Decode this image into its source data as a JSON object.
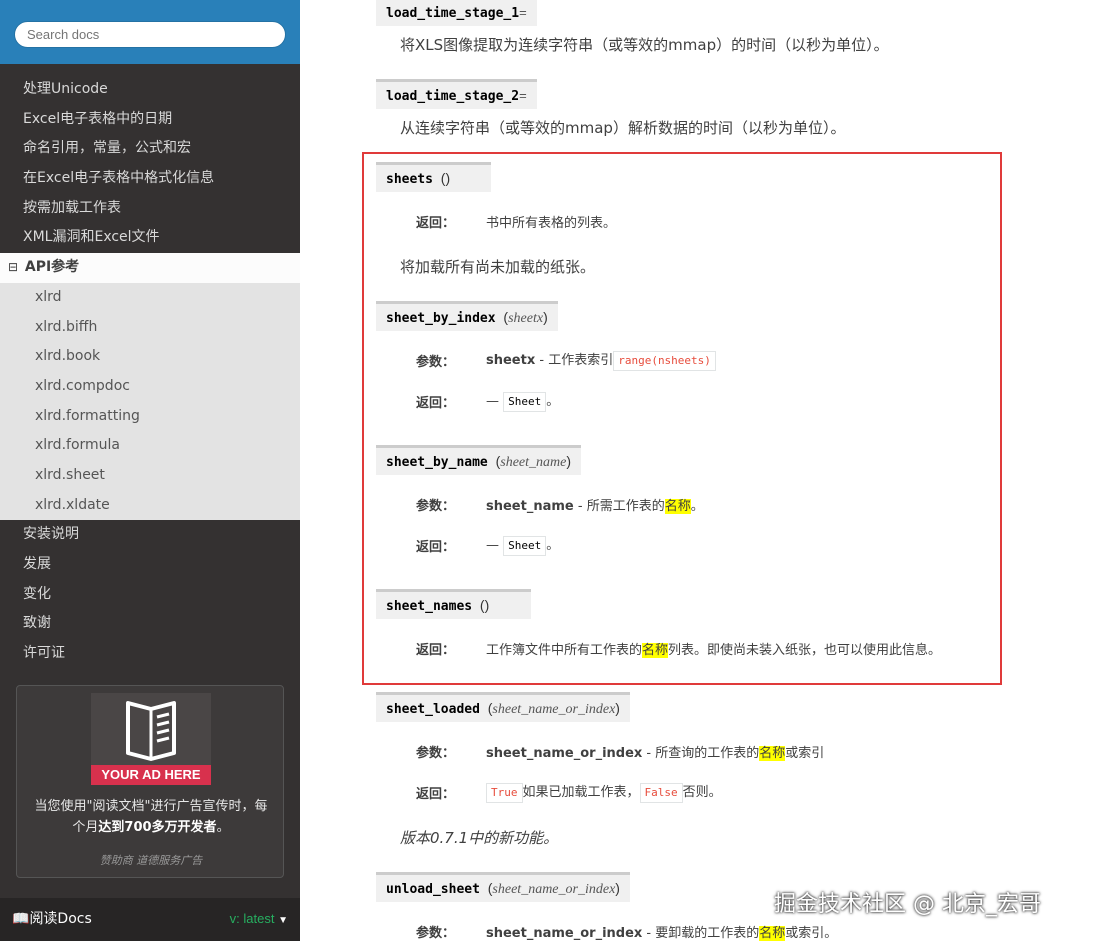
{
  "sidebar": {
    "search_placeholder": "Search docs",
    "items_top": [
      "处理Unicode",
      "Excel电子表格中的日期",
      "命名引用，常量，公式和宏",
      "在Excel电子表格中格式化信息",
      "按需加载工作表",
      "XML漏洞和Excel文件"
    ],
    "current": {
      "toggle": "⊟",
      "label": "API参考"
    },
    "sub_items": [
      "xlrd",
      "xlrd.biffh",
      "xlrd.book",
      "xlrd.compdoc",
      "xlrd.formatting",
      "xlrd.formula",
      "xlrd.sheet",
      "xlrd.xldate"
    ],
    "items_bottom": [
      "安装说明",
      "发展",
      "变化",
      "致谢",
      "许可证"
    ],
    "ad": {
      "label": "YOUR AD HERE",
      "text_line1": "当您使用\"阅读文档\"进行广告宣传时，每",
      "text_line2_pre": "个月",
      "text_line2_bold": "达到700多万开发者",
      "text_line2_post": "。",
      "sponsor": "赞助商 道德服务广告"
    },
    "footer": {
      "left": "阅读Docs",
      "version_prefix": "v: ",
      "version": "latest"
    }
  },
  "main": {
    "stage1": {
      "name": "load_time_stage_1",
      "eq": "=",
      "desc": "将XLS图像提取为连续字符串（或等效的mmap）的时间（以秒为单位）。"
    },
    "stage2": {
      "name": "load_time_stage_2",
      "eq": "=",
      "desc": "从连续字符串（或等效的mmap）解析数据的时间（以秒为单位）。"
    },
    "sheets": {
      "name": "sheets",
      "paren": "()",
      "returns_label": "返回：",
      "returns": "书中所有表格的列表。",
      "desc": "将加载所有尚未加载的纸张。"
    },
    "sheet_by_index": {
      "name": "sheet_by_index",
      "param": "sheetx",
      "params_label": "参数：",
      "param_name": "sheetx",
      "param_desc": " - 工作表索引",
      "code": "range(nsheets)",
      "returns_label": "返回：",
      "returns_dash": "— ",
      "returns_code": "Sheet",
      "returns_end": "。"
    },
    "sheet_by_name": {
      "name": "sheet_by_name",
      "param": "sheet_name",
      "params_label": "参数：",
      "param_name": "sheet_name",
      "param_desc": " - 所需工作表的",
      "param_hl": "名称",
      "param_end": "。",
      "returns_label": "返回：",
      "returns_dash": "— ",
      "returns_code": "Sheet",
      "returns_end": "。"
    },
    "sheet_names": {
      "name": "sheet_names",
      "paren": "()",
      "returns_label": "返回：",
      "returns_pre": "工作簿文件中所有工作表的",
      "returns_hl": "名称",
      "returns_post": "列表。即使尚未装入纸张，也可以使用此信息。"
    },
    "sheet_loaded": {
      "name": "sheet_loaded",
      "param": "sheet_name_or_index",
      "params_label": "参数：",
      "param_name": "sheet_name_or_index",
      "param_desc": " - 所查询的工作表的",
      "param_hl": "名称",
      "param_end": "或索引",
      "returns_label": "返回：",
      "code_true": "True",
      "mid": "如果已加载工作表，",
      "code_false": "False",
      "end": "否则。",
      "version_note": "版本0.7.1中的新功能。"
    },
    "unload_sheet": {
      "name": "unload_sheet",
      "param": "sheet_name_or_index",
      "params_label": "参数：",
      "param_name": "sheet_name_or_index",
      "param_desc": " - 要卸载的工作表的",
      "param_hl": "名称",
      "param_end": "或索引。"
    }
  },
  "watermark": "掘金技术社区 @ 北京_宏哥",
  "colors": {
    "sidebar_bg": "#343131",
    "search_bg": "#2980b9",
    "highlight_border": "#e03a3a",
    "highlight_text": "#ffff00",
    "code_red": "#e74c3c"
  }
}
